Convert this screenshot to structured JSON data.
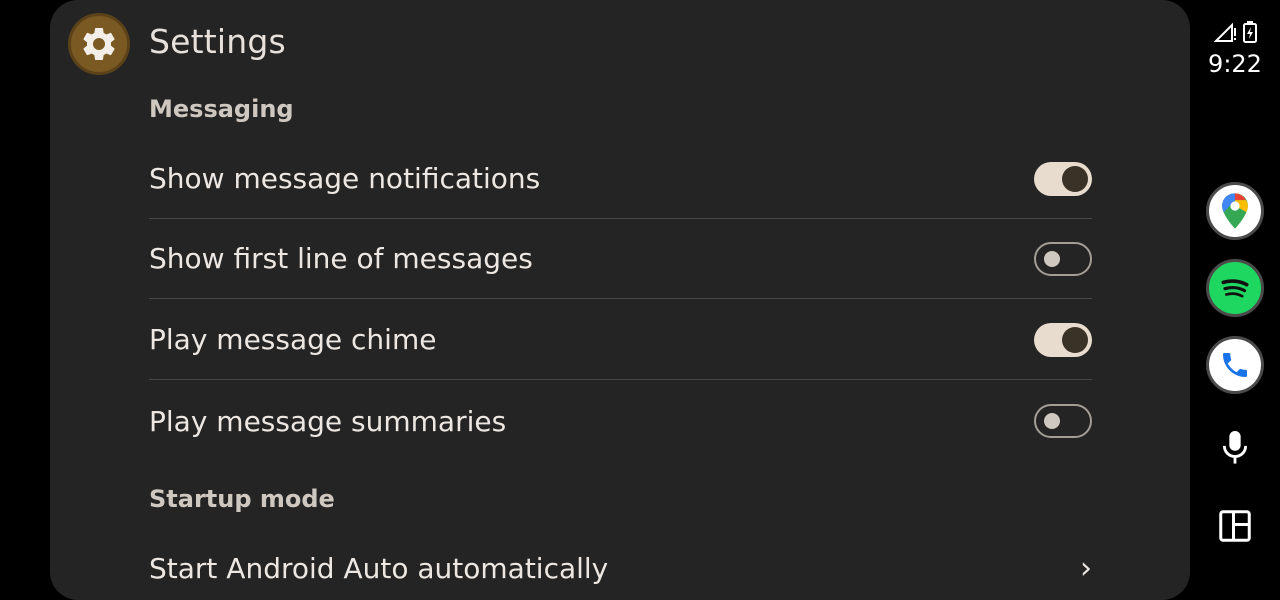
{
  "header": {
    "title": "Settings",
    "app_icon": "gear-icon"
  },
  "sections": [
    {
      "header": "Messaging",
      "rows": [
        {
          "label": "Show message notifications",
          "toggle": true
        },
        {
          "label": "Show first line of messages",
          "toggle": false
        },
        {
          "label": "Play message chime",
          "toggle": true
        },
        {
          "label": "Play message summaries",
          "toggle": false
        }
      ]
    },
    {
      "header": "Startup mode",
      "rows": [
        {
          "label": "Start Android Auto automatically",
          "chevron": "›"
        }
      ]
    }
  ],
  "status_bar": {
    "time": "9:22",
    "icons": [
      "signal-icon",
      "battery-icon"
    ]
  },
  "rail": {
    "apps": [
      "google-maps-icon",
      "spotify-icon",
      "phone-icon"
    ],
    "buttons": [
      "microphone-icon",
      "dashboard-layout-icon"
    ]
  },
  "colors": {
    "panel_bg": "#242424",
    "toggle_on": "#e8dccf",
    "spotify_green": "#1ed760",
    "app_icon_bg": "#7a5a22"
  }
}
